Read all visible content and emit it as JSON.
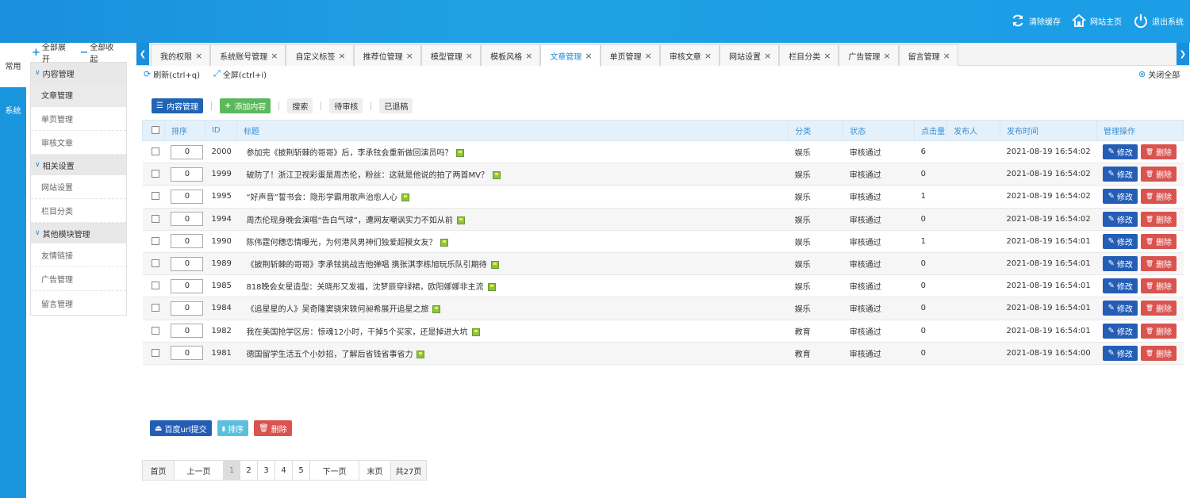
{
  "header": {
    "clear_cache": "清除缓存",
    "site_home": "网站主页",
    "logout": "退出系统"
  },
  "rail": {
    "items": [
      "常用",
      "系统"
    ]
  },
  "sidemenu": {
    "expand_all": "全部展开",
    "collapse_all": "全部收起",
    "groups": [
      {
        "title": "内容管理",
        "items": [
          "文章管理",
          "单页管理",
          "审核文章"
        ]
      },
      {
        "title": "相关设置",
        "items": [
          "网站设置",
          "栏目分类"
        ]
      },
      {
        "title": "其他模块管理",
        "items": [
          "友情链接",
          "广告管理",
          "留言管理"
        ]
      }
    ]
  },
  "tabs": [
    "我的权限",
    "系统账号管理",
    "自定义标签",
    "推荐位管理",
    "模型管理",
    "模板风格",
    "文章管理",
    "单页管理",
    "审核文章",
    "网站设置",
    "栏目分类",
    "广告管理",
    "留言管理"
  ],
  "active_tab": "文章管理",
  "toolbar": {
    "refresh": "刷新(ctrl+q)",
    "fullscreen": "全屏(ctrl+i)",
    "close_all": "关闭全部"
  },
  "actions": {
    "content_manage": "内容管理",
    "add_content": "添加内容",
    "search": "搜索",
    "pending": "待审核",
    "returned": "已退稿"
  },
  "table": {
    "headers": [
      "排序",
      "ID",
      "标题",
      "分类",
      "状态",
      "点击量",
      "发布人",
      "发布时间",
      "管理操作"
    ],
    "edit_label": "修改",
    "delete_label": "删除",
    "rows": [
      {
        "sort": "0",
        "id": "2000",
        "title": "参加完《披荆斩棘的哥哥》后，李承铉会重新做回演员吗？",
        "category": "娱乐",
        "status": "审核通过",
        "clicks": "6",
        "publisher": "",
        "time": "2021-08-19 16:54:02"
      },
      {
        "sort": "0",
        "id": "1999",
        "title": "破防了！浙江卫视彩蛋是周杰伦，粉丝：这就是他说的拍了两首MV？",
        "category": "娱乐",
        "status": "审核通过",
        "clicks": "0",
        "publisher": "",
        "time": "2021-08-19 16:54:02"
      },
      {
        "sort": "0",
        "id": "1995",
        "title": "“好声音”誓书会：隐形学霸用歌声治愈人心",
        "category": "娱乐",
        "status": "审核通过",
        "clicks": "1",
        "publisher": "",
        "time": "2021-08-19 16:54:02"
      },
      {
        "sort": "0",
        "id": "1994",
        "title": "周杰伦现身晚会演唱“告白气球”，遭网友嘲讽实力不如从前",
        "category": "娱乐",
        "status": "审核通过",
        "clicks": "0",
        "publisher": "",
        "time": "2021-08-19 16:54:02"
      },
      {
        "sort": "0",
        "id": "1990",
        "title": "陈伟霆何穗恋情曝光，为何港风男神们独爱超模女友？",
        "category": "娱乐",
        "status": "审核通过",
        "clicks": "1",
        "publisher": "",
        "time": "2021-08-19 16:54:01"
      },
      {
        "sort": "0",
        "id": "1989",
        "title": "《披荆斩棘的哥哥》李承铉挑战吉他弹唱 携张淇李栋旭玩乐队引期待",
        "category": "娱乐",
        "status": "审核通过",
        "clicks": "0",
        "publisher": "",
        "time": "2021-08-19 16:54:01"
      },
      {
        "sort": "0",
        "id": "1985",
        "title": "818晚会女星造型：关晓彤又发福，沈梦辰穿绿裙，欧阳娜娜非主流",
        "category": "娱乐",
        "status": "审核通过",
        "clicks": "0",
        "publisher": "",
        "time": "2021-08-19 16:54:01"
      },
      {
        "sort": "0",
        "id": "1984",
        "title": "《追星星的人》吴奇隆窦骁宋轶何昶希展开追星之旅",
        "category": "娱乐",
        "status": "审核通过",
        "clicks": "0",
        "publisher": "",
        "time": "2021-08-19 16:54:01"
      },
      {
        "sort": "0",
        "id": "1982",
        "title": "我在美国抢学区房：惊魂12小时，干掉5个买家，还是掉进大坑",
        "category": "教育",
        "status": "审核通过",
        "clicks": "0",
        "publisher": "",
        "time": "2021-08-19 16:54:01"
      },
      {
        "sort": "0",
        "id": "1981",
        "title": "德国留学生活五个小妙招，了解后省钱省事省力",
        "category": "教育",
        "status": "审核通过",
        "clicks": "0",
        "publisher": "",
        "time": "2021-08-19 16:54:00"
      }
    ]
  },
  "bottom_actions": {
    "baidu_submit": "百度url提交",
    "sort": "排序",
    "delete": "删除"
  },
  "pager": {
    "first": "首页",
    "prev": "上一页",
    "pages": [
      "1",
      "2",
      "3",
      "4",
      "5"
    ],
    "next": "下一页",
    "last": "末页",
    "total": "共27页"
  },
  "colors": {
    "header": "#1a8fdc",
    "rail": "#1a96de",
    "accent": "#1a8fdc",
    "edit": "#245db6",
    "delete": "#d9534f",
    "add": "#5cb85c"
  }
}
